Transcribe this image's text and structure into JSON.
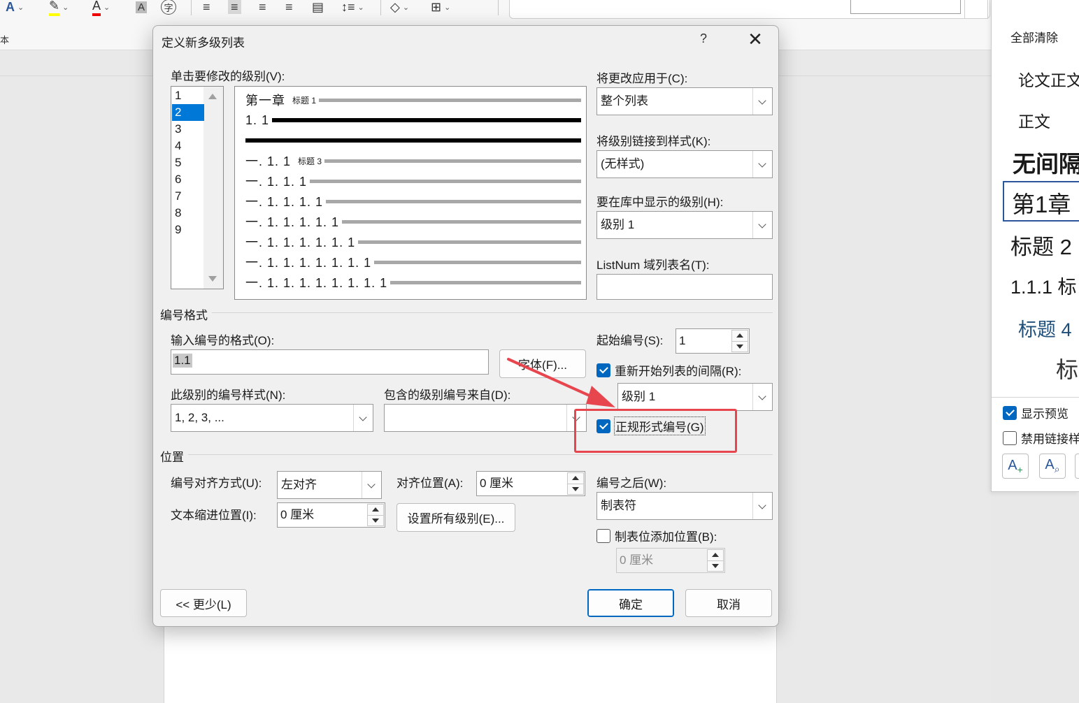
{
  "colors": {
    "accent": "#0067c0",
    "selection": "#0078d7",
    "annotation": "#e8464f"
  },
  "ribbon": {
    "icons": [
      "font-color-a-icon",
      "highlight-marker-icon",
      "font-color-red-a-icon",
      "character-shading-icon",
      "enclosed-character-icon",
      "align-left-icon",
      "center-icon",
      "align-right-icon",
      "justify-icon",
      "distributed-icon",
      "line-spacing-icon",
      "shading-icon",
      "borders-icon"
    ],
    "left_glyph": "本"
  },
  "styles_pane": {
    "clear_all": "全部清除",
    "items": [
      "论文正文",
      "正文",
      "无间隔",
      "第1章",
      "标题 2",
      "1.1.1  标",
      "标题 4",
      "标"
    ],
    "selected_item": "第1章",
    "show_preview": "显示预览",
    "disable_linked": "禁用链接样",
    "new_style_icon": "A",
    "inspector_icon": "A"
  },
  "dialog": {
    "title": "定义新多级列表",
    "help": "?",
    "close": "✕",
    "level_label": "单击要修改的级别(V):",
    "level_label_key": "V",
    "levels": [
      "1",
      "2",
      "3",
      "4",
      "5",
      "6",
      "7",
      "8",
      "9"
    ],
    "selected_level": "2",
    "preview_rows": [
      {
        "text": "第一章",
        "tag": "标题 1",
        "dark": false
      },
      {
        "text": "1. 1",
        "tag": "",
        "dark": true
      },
      {
        "text": "",
        "tag": "",
        "dark": true
      },
      {
        "text": "一. 1. 1",
        "tag": "标题 3",
        "dark": false
      },
      {
        "text": "一. 1. 1. 1",
        "tag": "",
        "dark": false
      },
      {
        "text": "一. 1. 1. 1. 1",
        "tag": "",
        "dark": false
      },
      {
        "text": "一. 1. 1. 1. 1. 1",
        "tag": "",
        "dark": false
      },
      {
        "text": "一. 1. 1. 1. 1. 1. 1",
        "tag": "",
        "dark": false
      },
      {
        "text": "一. 1. 1. 1. 1. 1. 1. 1",
        "tag": "",
        "dark": false
      },
      {
        "text": "一. 1. 1. 1. 1. 1. 1. 1. 1",
        "tag": "",
        "dark": false
      }
    ],
    "apply_to_label": "将更改应用于(C):",
    "apply_to_value": "整个列表",
    "link_style_label": "将级别链接到样式(K):",
    "link_style_value": "(无样式)",
    "gallery_level_label": "要在库中显示的级别(H):",
    "gallery_level_value": "级别 1",
    "listnum_label": "ListNum 域列表名(T):",
    "listnum_value": "",
    "number_format_section": "编号格式",
    "enter_format_label": "输入编号的格式(O):",
    "enter_format_value": "1.1",
    "font_button": "字体(F)...",
    "number_style_label": "此级别的编号样式(N):",
    "number_style_value": "1, 2, 3, ...",
    "include_from_label": "包含的级别编号来自(D):",
    "include_from_value": "",
    "start_at_label": "起始编号(S):",
    "start_at_value": "1",
    "restart_label": "重新开始列表的间隔(R):",
    "restart_checked": true,
    "restart_value": "级别 1",
    "legal_label": "正规形式编号(G)",
    "legal_checked": true,
    "position_section": "位置",
    "alignment_label": "编号对齐方式(U):",
    "alignment_value": "左对齐",
    "aligned_at_label": "对齐位置(A):",
    "aligned_at_value": "0 厘米",
    "indent_label": "文本缩进位置(I):",
    "indent_value": "0 厘米",
    "set_all_button": "设置所有级别(E)...",
    "follow_label": "编号之后(W):",
    "follow_value": "制表符",
    "tab_stop_label": "制表位添加位置(B):",
    "tab_stop_checked": false,
    "tab_stop_value": "0 厘米",
    "less_button": "<< 更少(L)",
    "ok_button": "确定",
    "cancel_button": "取消"
  }
}
